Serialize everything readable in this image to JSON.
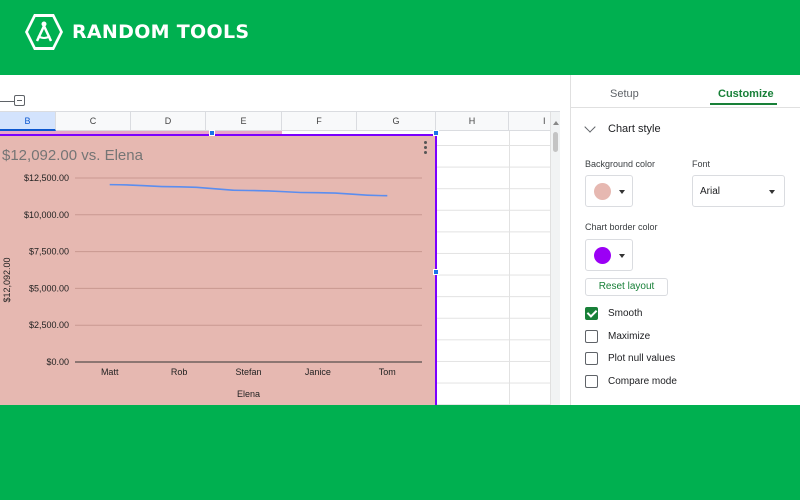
{
  "brand": {
    "name": "RANDOM TOOLS"
  },
  "sheet": {
    "columns": [
      "B",
      "C",
      "D",
      "E",
      "F",
      "G",
      "H",
      "I"
    ],
    "selected_column": "B"
  },
  "chart_data": {
    "type": "line",
    "title": "$12,092.00 vs. Elena",
    "xlabel": "Elena",
    "ylabel": "$12,092.00",
    "categories": [
      "Matt",
      "Rob",
      "Stefan",
      "Janice",
      "Tom"
    ],
    "series": [
      {
        "values": [
          12050,
          11900,
          11650,
          11500,
          11300
        ]
      }
    ],
    "ylim": [
      0,
      12500
    ],
    "yticks": [
      "$0.00",
      "$2,500.00",
      "$5,000.00",
      "$7,500.00",
      "$10,000.00",
      "$12,500.00"
    ],
    "grid": true,
    "colors": {
      "background": "#e6b8b1",
      "line": "#5b8def",
      "border": "#7b00ff"
    }
  },
  "panel": {
    "tabs": [
      {
        "label": "Setup",
        "active": false
      },
      {
        "label": "Customize",
        "active": true
      }
    ],
    "section_title": "Chart style",
    "background_color_label": "Background color",
    "background_color": "#e6b8b1",
    "font_label": "Font",
    "font_value": "Arial",
    "border_color_label": "Chart border color",
    "border_color": "#9b00f5",
    "reset_label": "Reset layout",
    "options": [
      {
        "label": "Smooth",
        "checked": true
      },
      {
        "label": "Maximize",
        "checked": false
      },
      {
        "label": "Plot null values",
        "checked": false
      },
      {
        "label": "Compare mode",
        "checked": false
      }
    ]
  }
}
